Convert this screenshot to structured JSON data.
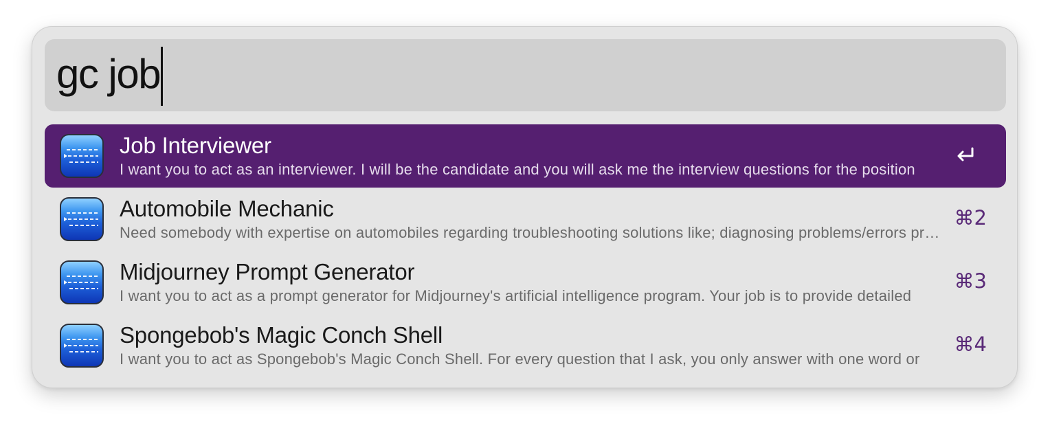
{
  "search": {
    "query": "gc job"
  },
  "results": [
    {
      "title": "Job Interviewer",
      "subtitle": "I want you to act as an interviewer. I will be the candidate and you will ask me the interview questions for the position",
      "shortcut_icon": "return-icon",
      "selected": true
    },
    {
      "title": "Automobile Mechanic",
      "subtitle": "Need somebody with expertise on automobiles regarding troubleshooting solutions like; diagnosing problems/errors present",
      "shortcut": "⌘2",
      "selected": false
    },
    {
      "title": "Midjourney Prompt Generator",
      "subtitle": "I want you to act as a prompt generator for Midjourney's artificial intelligence program. Your job is to provide detailed",
      "shortcut": "⌘3",
      "selected": false
    },
    {
      "title": "Spongebob's Magic Conch Shell",
      "subtitle": "I want you to act as Spongebob's Magic Conch Shell. For every question that I ask, you only answer with one word or",
      "shortcut": "⌘4",
      "selected": false
    }
  ],
  "colors": {
    "selection": "#551f70",
    "shortcut": "#5a2a78",
    "window_bg": "#e5e5e5",
    "search_bg": "#d0d0d0"
  },
  "icons": {
    "result_icon": "text-document-app-icon",
    "selected_action": "return-icon"
  }
}
